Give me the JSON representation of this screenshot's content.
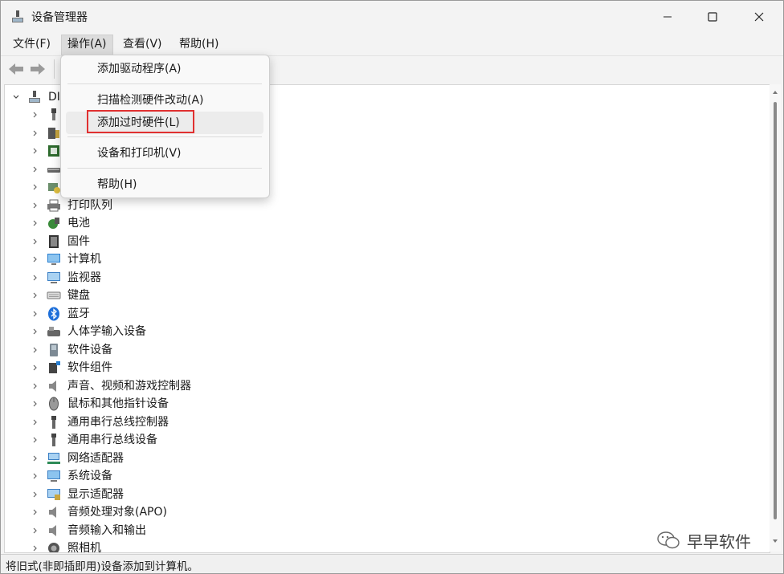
{
  "window": {
    "title": "设备管理器"
  },
  "menubar": {
    "items": [
      "文件(F)",
      "操作(A)",
      "查看(V)",
      "帮助(H)"
    ],
    "active_index": 1
  },
  "dropdown": {
    "items": [
      "添加驱动程序(A)",
      "扫描检测硬件改动(A)",
      "添加过时硬件(L)",
      "设备和打印机(V)",
      "帮助(H)"
    ],
    "hovered_index": 2
  },
  "tree": {
    "root_label": "DI",
    "nodes": [
      {
        "label": "",
        "icon": "usb-plug-icon"
      },
      {
        "label": "",
        "icon": "usb-controller-icon"
      },
      {
        "label": "",
        "icon": "processor-icon"
      },
      {
        "label": "",
        "icon": "disk-drive-icon"
      },
      {
        "label": "",
        "icon": "storage-controller-icon"
      },
      {
        "label": "打印队列",
        "icon": "printer-icon"
      },
      {
        "label": "电池",
        "icon": "battery-icon"
      },
      {
        "label": "固件",
        "icon": "firmware-icon"
      },
      {
        "label": "计算机",
        "icon": "computer-icon"
      },
      {
        "label": "监视器",
        "icon": "monitor-icon"
      },
      {
        "label": "键盘",
        "icon": "keyboard-icon"
      },
      {
        "label": "蓝牙",
        "icon": "bluetooth-icon"
      },
      {
        "label": "人体学输入设备",
        "icon": "hid-icon"
      },
      {
        "label": "软件设备",
        "icon": "software-device-icon"
      },
      {
        "label": "软件组件",
        "icon": "software-component-icon"
      },
      {
        "label": "声音、视频和游戏控制器",
        "icon": "speaker-icon"
      },
      {
        "label": "鼠标和其他指针设备",
        "icon": "mouse-icon"
      },
      {
        "label": "通用串行总线控制器",
        "icon": "usb-icon"
      },
      {
        "label": "通用串行总线设备",
        "icon": "usb-icon"
      },
      {
        "label": "网络适配器",
        "icon": "network-icon"
      },
      {
        "label": "系统设备",
        "icon": "system-icon"
      },
      {
        "label": "显示适配器",
        "icon": "display-adapter-icon"
      },
      {
        "label": "音频处理对象(APO)",
        "icon": "speaker-icon"
      },
      {
        "label": "音频输入和输出",
        "icon": "speaker-icon"
      },
      {
        "label": "照相机",
        "icon": "camera-icon"
      }
    ]
  },
  "status": {
    "text": "将旧式(非即插即用)设备添加到计算机。"
  },
  "watermark": {
    "text": "早早软件"
  },
  "colors": {
    "highlight_border": "#e03030",
    "bluetooth": "#1e6fd9"
  }
}
